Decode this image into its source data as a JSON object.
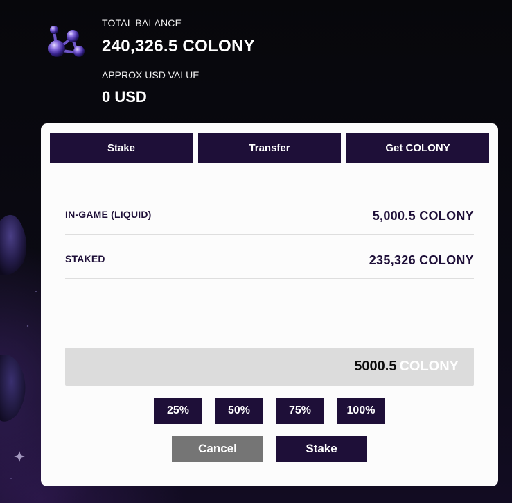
{
  "header": {
    "logo_icon": "colony-molecule-logo-icon",
    "total_balance_label": "TOTAL BALANCE",
    "total_balance_value": "240,326.5 COLONY",
    "usd_label": "APPROX USD VALUE",
    "usd_value": "0 USD"
  },
  "tabs": [
    {
      "label": "Stake"
    },
    {
      "label": "Transfer"
    },
    {
      "label": "Get COLONY"
    }
  ],
  "balances": {
    "liquid_label": "IN-GAME (LIQUID)",
    "liquid_value": "5,000.5 COLONY",
    "staked_label": "STAKED",
    "staked_value": "235,326 COLONY"
  },
  "amount_input": {
    "value": "5000.5",
    "unit": "COLONY"
  },
  "percent_buttons": [
    "25%",
    "50%",
    "75%",
    "100%"
  ],
  "actions": {
    "cancel_label": "Cancel",
    "stake_label": "Stake"
  },
  "colors": {
    "accent": "#1e0f38",
    "cancel": "#757575",
    "card": "#fcfcfc",
    "input_bg": "#dcdcdc"
  }
}
